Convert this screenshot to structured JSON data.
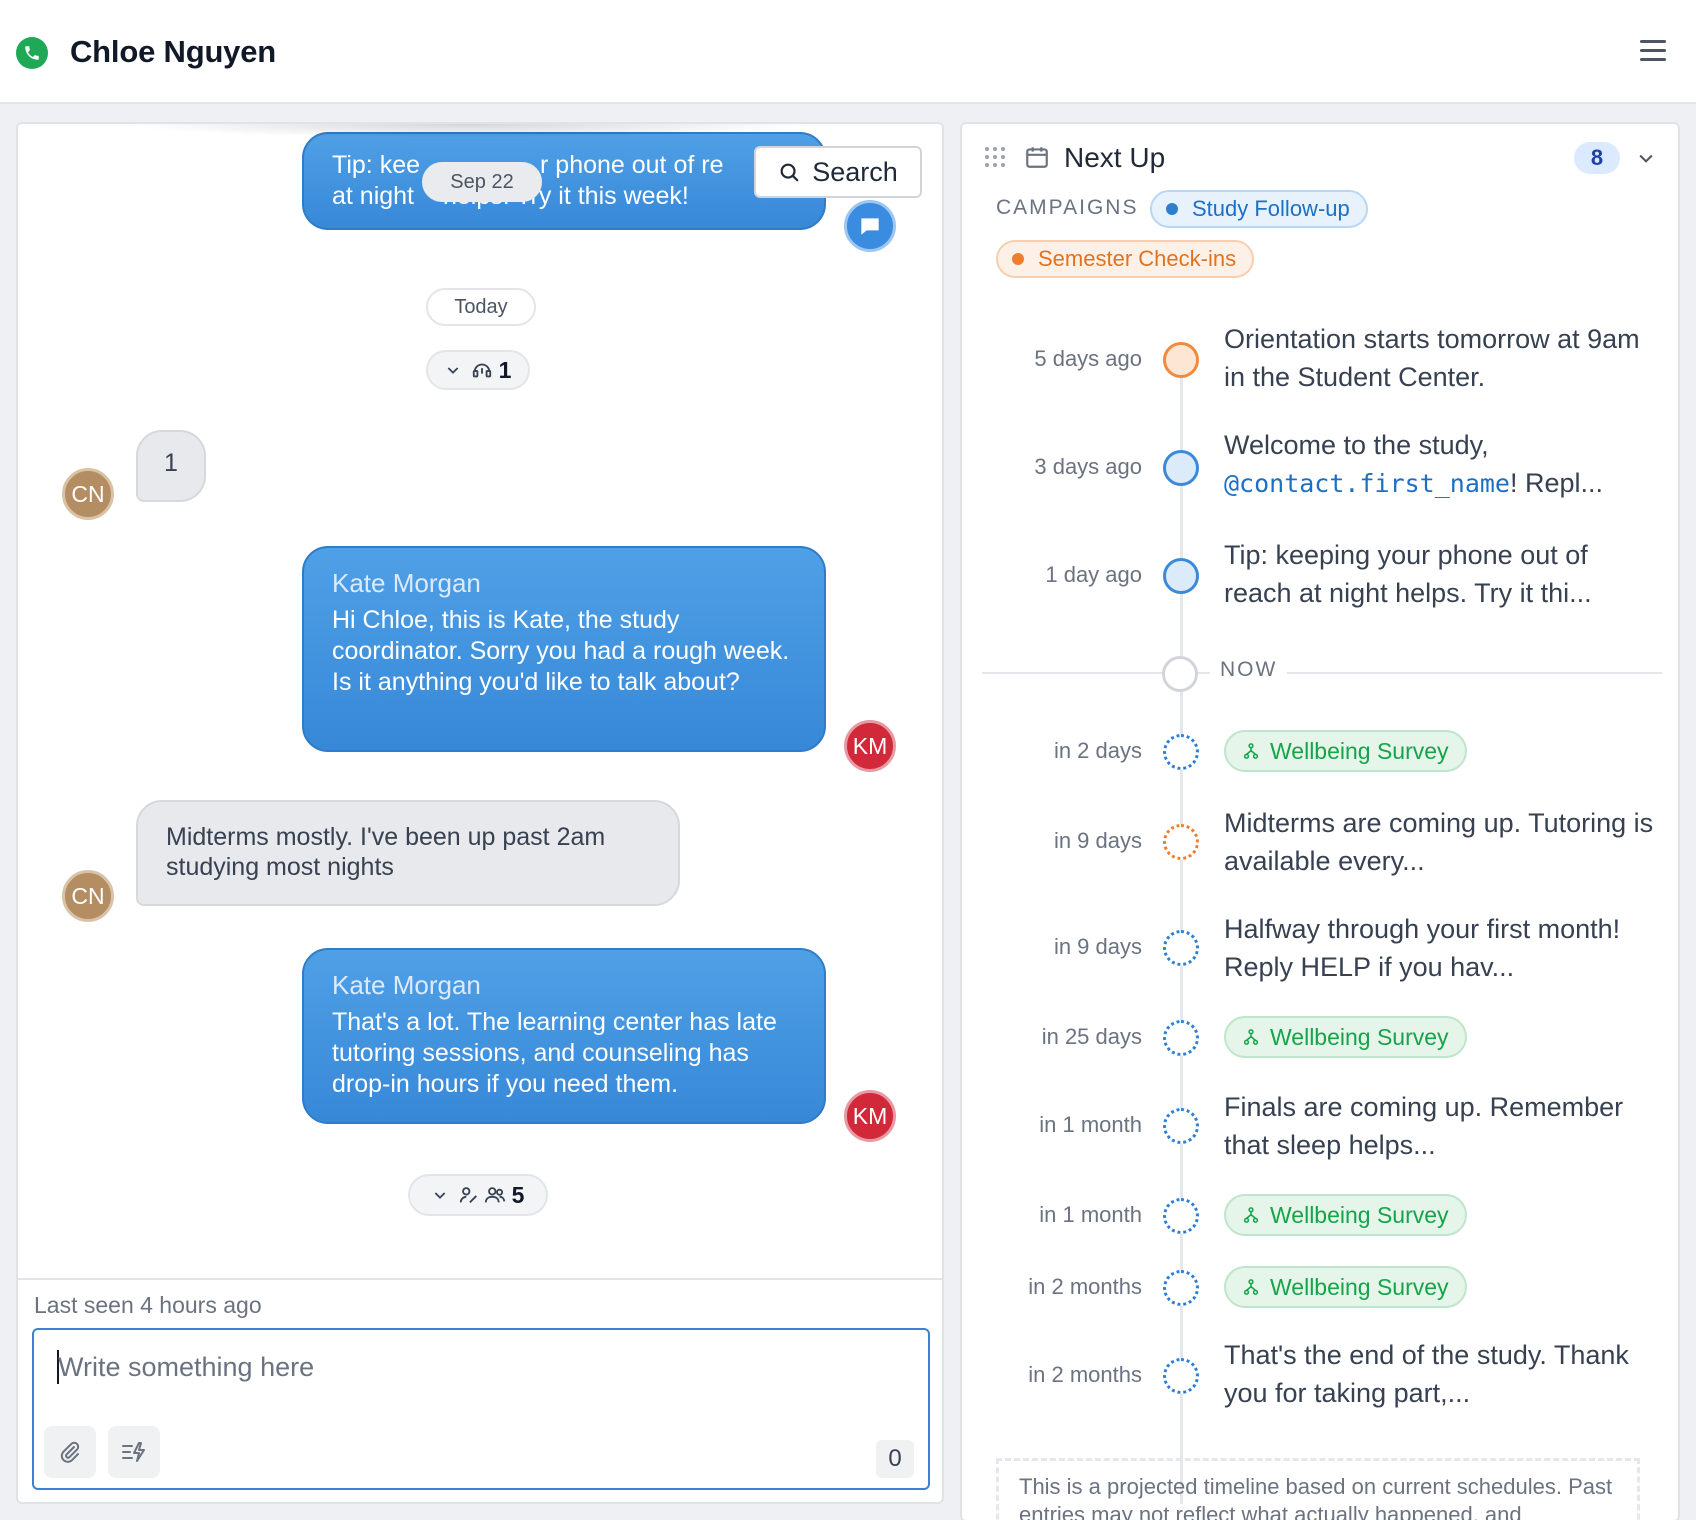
{
  "header": {
    "contact_name": "Chloe Nguyen",
    "status_color": "#1fa855",
    "phone_icon": "phone-icon",
    "menu_icon": "hamburger-menu-icon"
  },
  "chat": {
    "search_label": "Search",
    "date_chips": {
      "sep": "Sep 22",
      "today": "Today"
    },
    "messages": [
      {
        "direction": "outgoing",
        "text": "Tip: keeping your phone out of reach at night helps. Try it this week!",
        "visible_text_line1": "Tip: kee",
        "visible_text_line1b": "r phone out of re",
        "visible_text_line2a": "at night ",
        "visible_text_line2b": "helps. Try it this week!",
        "avatar": "system"
      },
      {
        "direction": "incoming",
        "text": "1",
        "avatar": "CN"
      },
      {
        "direction": "outgoing",
        "sender": "Kate Morgan",
        "text": "Hi Chloe, this is Kate, the study coordinator. Sorry you had a rough week. Is it anything you'd like to talk about?",
        "avatar": "KM"
      },
      {
        "direction": "incoming",
        "text": "Midterms mostly. I've been up past 2am studying most nights",
        "avatar": "CN"
      },
      {
        "direction": "outgoing",
        "sender": "Kate Morgan",
        "text": "That's a lot. The learning center has late tutoring sessions, and counseling has drop-in hours if you need them.",
        "avatar": "KM"
      }
    ],
    "collapsed_groups": [
      {
        "count": "1",
        "icons": [
          "chevron-down-icon",
          "headset-icon"
        ]
      },
      {
        "count": "5",
        "icons": [
          "chevron-down-icon",
          "signature-icon",
          "group-icon"
        ]
      }
    ],
    "last_seen": "Last seen 4 hours ago",
    "composer": {
      "placeholder": "Write something here",
      "char_count": "0"
    }
  },
  "next_up": {
    "title": "Next Up",
    "count": "8",
    "campaigns_label": "CAMPAIGNS",
    "campaigns": [
      {
        "name": "Study Follow-up",
        "color": "#2f7fd1"
      },
      {
        "name": "Semester Check-ins",
        "color": "#ee7d2e"
      }
    ],
    "now_label": "NOW",
    "timeline": [
      {
        "time": "5 days ago",
        "text": "Orientation starts tomorrow at 9am in the Student Center.",
        "kind": "past",
        "color": "#f08a3e"
      },
      {
        "time": "3 days ago",
        "text_before": "Welcome to the study,",
        "mention": "@contact.first_name",
        "text_after": "! Repl...",
        "kind": "past",
        "color": "#3b8ad9"
      },
      {
        "time": "1 day ago",
        "text": "Tip: keeping your phone out of reach at night helps. Try it thi...",
        "kind": "past",
        "color": "#3b8ad9"
      },
      {
        "time": "in 2 days",
        "survey": "Wellbeing Survey",
        "kind": "future",
        "color": "#2f7fd1"
      },
      {
        "time": "in 9 days",
        "text": "Midterms are coming up. Tutoring is available every...",
        "kind": "future",
        "color": "#ee7d2e"
      },
      {
        "time": "in 9 days",
        "text": "Halfway through your first month! Reply HELP if you hav...",
        "kind": "future",
        "color": "#2f7fd1"
      },
      {
        "time": "in 25 days",
        "survey": "Wellbeing Survey",
        "kind": "future",
        "color": "#2f7fd1"
      },
      {
        "time": "in 1 month",
        "text": "Finals are coming up. Remember that sleep helps...",
        "kind": "future",
        "color": "#2f7fd1"
      },
      {
        "time": "in 1 month",
        "survey": "Wellbeing Survey",
        "kind": "future",
        "color": "#2f7fd1"
      },
      {
        "time": "in 2 months",
        "survey": "Wellbeing Survey",
        "kind": "future",
        "color": "#2f7fd1"
      },
      {
        "time": "in 2 months",
        "text": "That's the end of the study. Thank you for taking part,...",
        "kind": "future",
        "color": "#2f7fd1"
      }
    ],
    "disclaimer": "This is a projected timeline based on current schedules. Past entries may not reflect what actually happened, and"
  }
}
